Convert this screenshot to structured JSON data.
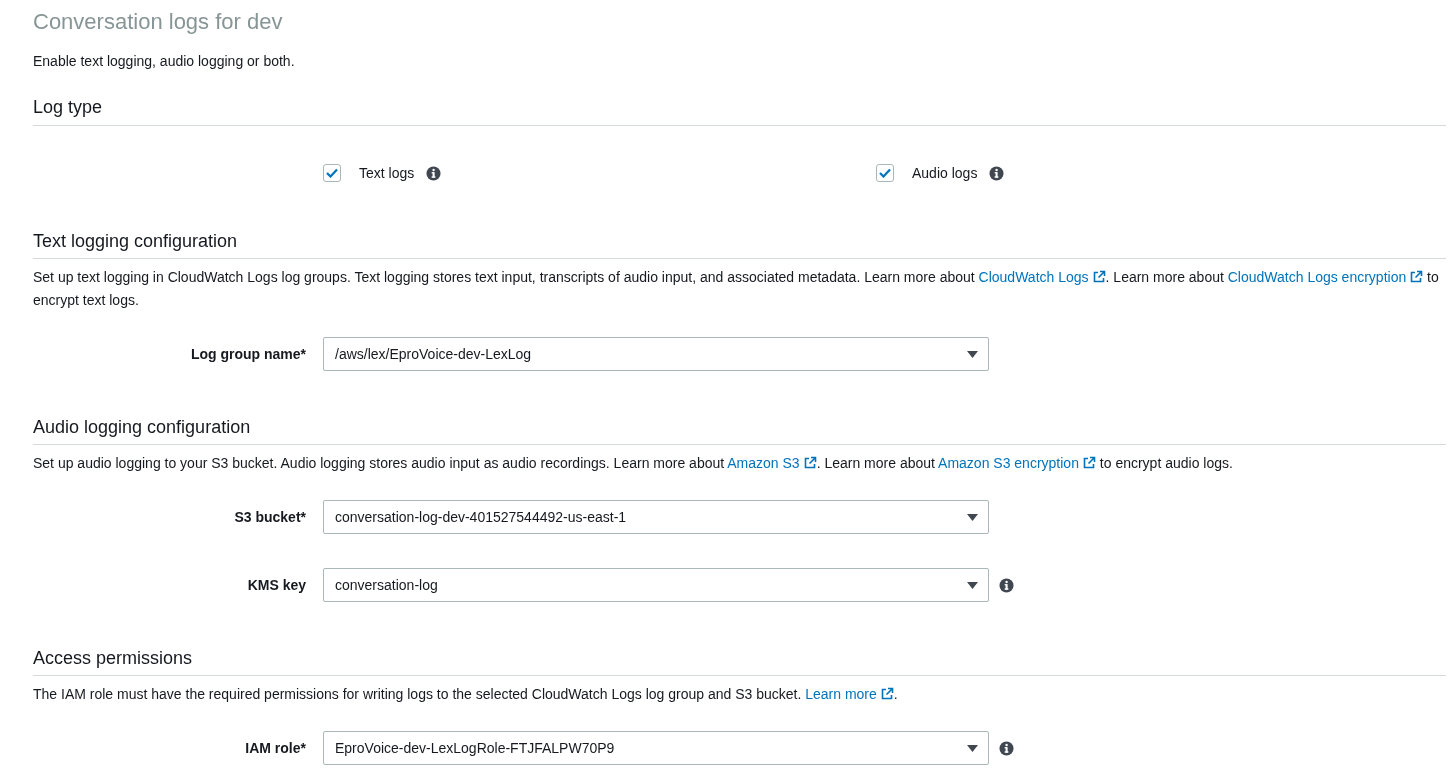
{
  "title": "Conversation logs for dev",
  "subtitle": "Enable text logging, audio logging or both.",
  "log_type": {
    "heading": "Log type",
    "options": [
      {
        "label": "Text logs",
        "checked": true,
        "info": true
      },
      {
        "label": "Audio logs",
        "checked": true,
        "info": true
      }
    ]
  },
  "sections": [
    {
      "heading": "Text logging configuration",
      "description": [
        {
          "kind": "text",
          "text": "Set up text logging in CloudWatch Logs log groups. Text logging stores text input, transcripts of audio input, and associated metadata. Learn more about "
        },
        {
          "kind": "link",
          "text": "CloudWatch Logs"
        },
        {
          "kind": "text",
          "text": ". Learn more about "
        },
        {
          "kind": "link",
          "text": "CloudWatch Logs encryption"
        },
        {
          "kind": "text",
          "text": " to encrypt text logs."
        }
      ],
      "fields": [
        {
          "label": "Log group name*",
          "value": "/aws/lex/EproVoice-dev-LexLog",
          "info": false
        }
      ]
    },
    {
      "heading": "Audio logging configuration",
      "description": [
        {
          "kind": "text",
          "text": "Set up audio logging to your S3 bucket. Audio logging stores audio input as audio recordings. Learn more about "
        },
        {
          "kind": "link",
          "text": "Amazon S3"
        },
        {
          "kind": "text",
          "text": ". Learn more about "
        },
        {
          "kind": "link",
          "text": "Amazon S3 encryption"
        },
        {
          "kind": "text",
          "text": " to encrypt audio logs."
        }
      ],
      "fields": [
        {
          "label": "S3 bucket*",
          "value": "conversation-log-dev-401527544492-us-east-1",
          "info": false
        },
        {
          "label": "KMS key",
          "value": "conversation-log",
          "info": true
        }
      ]
    },
    {
      "heading": "Access permissions",
      "description": [
        {
          "kind": "text",
          "text": "The IAM role must have the required permissions for writing logs to the selected CloudWatch Logs log group and S3 bucket. "
        },
        {
          "kind": "link",
          "text": "Learn more"
        },
        {
          "kind": "text",
          "text": "."
        }
      ],
      "fields": [
        {
          "label": "IAM role*",
          "value": "EproVoice-dev-LexLogRole-FTJFALPW70P9",
          "info": true
        }
      ]
    }
  ]
}
